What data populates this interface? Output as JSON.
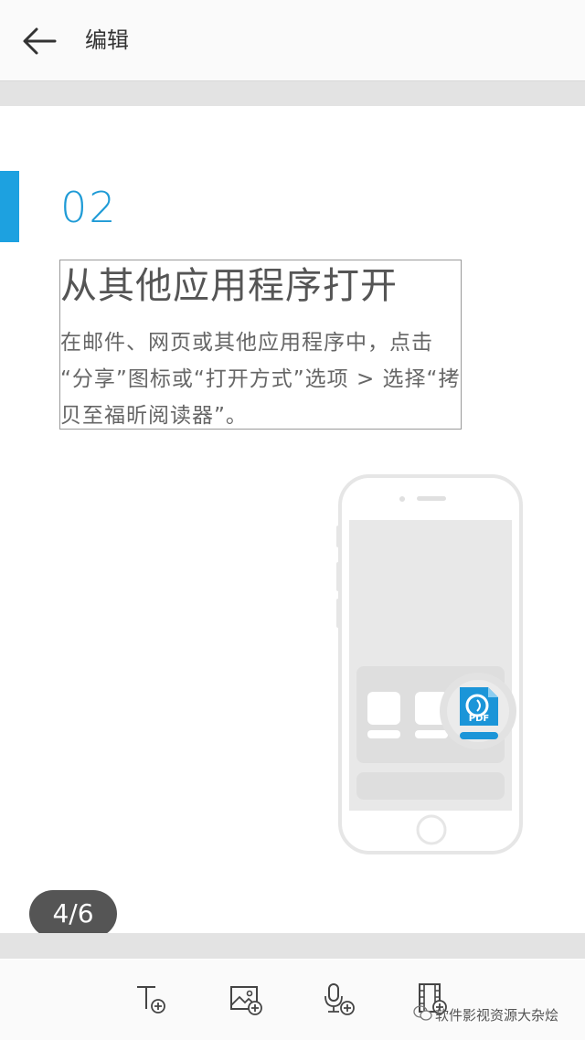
{
  "topbar": {
    "title": "编辑",
    "back_icon": "arrow-left-icon"
  },
  "slide": {
    "step_number": "02",
    "heading": "从其他应用程序打开",
    "body_lines": [
      "在邮件、网页或其他应用程序中，点击",
      "“分享”图标或“打开方式”选项 > 选择“拷",
      "贝至福昕阅读器”。"
    ],
    "pdf_badge": "PDF",
    "accent_color": "#1da1e0"
  },
  "page_indicator": "4/6",
  "toolbar": {
    "items": [
      "insert-text-icon",
      "insert-image-icon",
      "insert-audio-icon",
      "insert-video-icon"
    ]
  },
  "watermark": "软件影视资源大杂烩"
}
